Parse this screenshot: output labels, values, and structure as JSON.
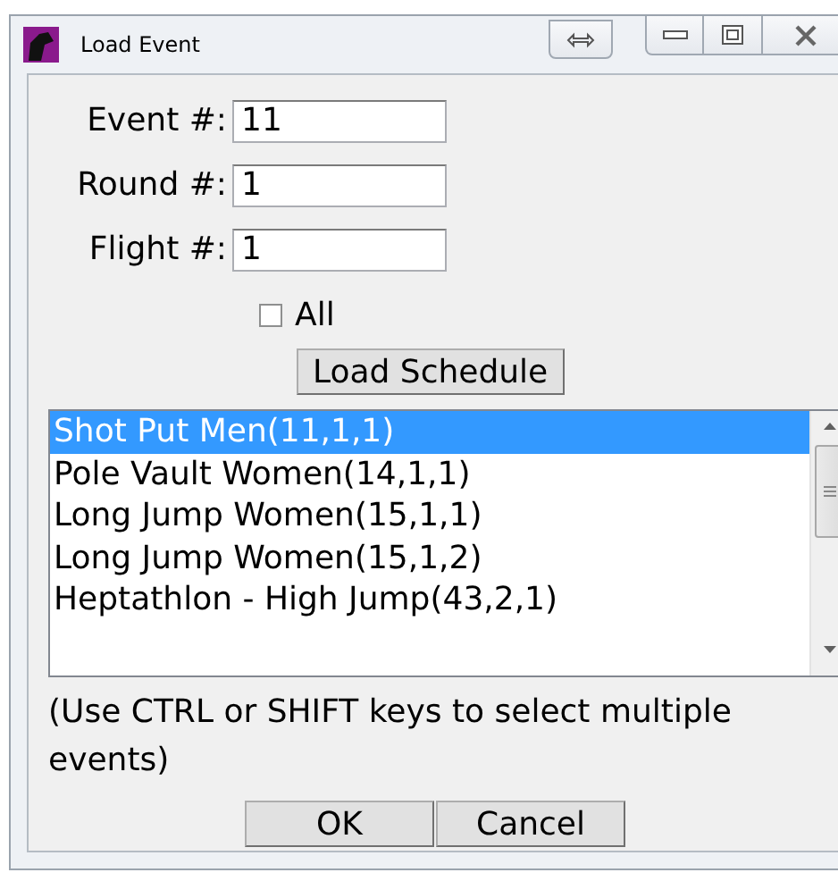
{
  "window": {
    "title": "Load Event"
  },
  "fields": [
    {
      "label": "Event #:",
      "value": "11"
    },
    {
      "label": "Round #:",
      "value": "1"
    },
    {
      "label": "Flight #:",
      "value": "1"
    }
  ],
  "all_checkbox": {
    "label": "All",
    "checked": false
  },
  "load_button": "Load Schedule",
  "events": [
    {
      "label": "Shot Put Men(11,1,1)",
      "selected": true
    },
    {
      "label": "Pole Vault Women(14,1,1)",
      "selected": false
    },
    {
      "label": "Long Jump Women(15,1,1)",
      "selected": false
    },
    {
      "label": "Long Jump Women(15,1,2)",
      "selected": false
    },
    {
      "label": "Heptathlon - High Jump(43,2,1)",
      "selected": false
    }
  ],
  "hint": "(Use CTRL or SHIFT keys to select multiple events)",
  "buttons": [
    "OK",
    "Cancel"
  ]
}
